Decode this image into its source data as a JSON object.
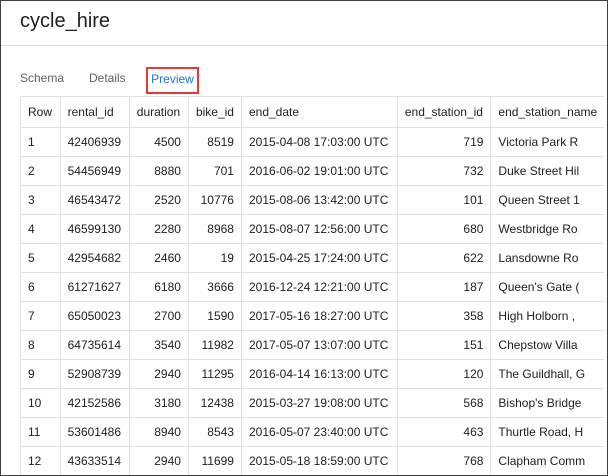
{
  "title": "cycle_hire",
  "tabs": [
    {
      "label": "Schema",
      "active": false
    },
    {
      "label": "Details",
      "active": false
    },
    {
      "label": "Preview",
      "active": true
    }
  ],
  "table": {
    "headers": [
      "Row",
      "rental_id",
      "duration",
      "bike_id",
      "end_date",
      "end_station_id",
      "end_station_name"
    ],
    "rows": [
      [
        "1",
        "42406939",
        "4500",
        "8519",
        "2015-04-08 17:03:00 UTC",
        "719",
        "Victoria Park R"
      ],
      [
        "2",
        "54456949",
        "8880",
        "701",
        "2016-06-02 19:01:00 UTC",
        "732",
        "Duke Street Hil"
      ],
      [
        "3",
        "46543472",
        "2520",
        "10776",
        "2015-08-06 13:42:00 UTC",
        "101",
        "Queen Street 1"
      ],
      [
        "4",
        "46599130",
        "2280",
        "8968",
        "2015-08-07 12:56:00 UTC",
        "680",
        "Westbridge Ro"
      ],
      [
        "5",
        "42954682",
        "2460",
        "19",
        "2015-04-25 17:24:00 UTC",
        "622",
        "Lansdowne Ro"
      ],
      [
        "6",
        "61271627",
        "6180",
        "3666",
        "2016-12-24 12:21:00 UTC",
        "187",
        "Queen's Gate ("
      ],
      [
        "7",
        "65050023",
        "2700",
        "1590",
        "2017-05-16 18:27:00 UTC",
        "358",
        "High Holborn ,"
      ],
      [
        "8",
        "64735614",
        "3540",
        "11982",
        "2017-05-07 13:07:00 UTC",
        "151",
        "Chepstow Villa"
      ],
      [
        "9",
        "52908739",
        "2940",
        "11295",
        "2016-04-14 16:13:00 UTC",
        "120",
        "The Guildhall, G"
      ],
      [
        "10",
        "42152586",
        "3180",
        "12438",
        "2015-03-27 19:08:00 UTC",
        "568",
        "Bishop's Bridge"
      ],
      [
        "11",
        "53601486",
        "8940",
        "8543",
        "2016-05-07 23:40:00 UTC",
        "463",
        "Thurtle Road, H"
      ],
      [
        "12",
        "43633514",
        "2940",
        "11699",
        "2015-05-18 18:59:00 UTC",
        "768",
        "Clapham Comm"
      ]
    ]
  }
}
